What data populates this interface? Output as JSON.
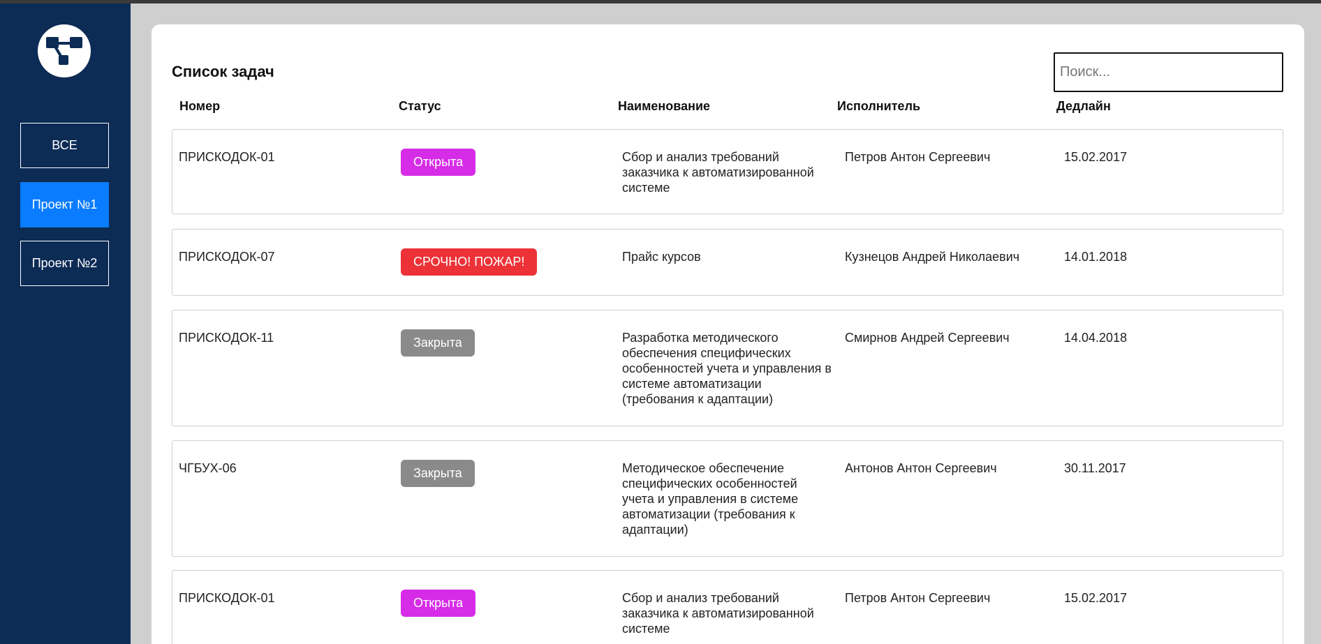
{
  "sidebar": {
    "logo_icon": "hierarchy-icon",
    "items": [
      {
        "label": "ВСЕ",
        "active": false
      },
      {
        "label": "Проект №1",
        "active": true
      },
      {
        "label": "Проект №2",
        "active": false
      }
    ]
  },
  "main": {
    "title": "Список задач",
    "search": {
      "placeholder": "Поиск...",
      "value": ""
    },
    "columns": [
      "Номер",
      "Статус",
      "Наименование",
      "Исполнитель",
      "Дедлайн"
    ],
    "status_colors": {
      "Открыта": "#d62ce8",
      "СРОЧНО! ПОЖАР!": "#ec3237",
      "Закрыта": "#8a8a8a"
    },
    "rows": [
      {
        "number": "ПРИСКОДОК-01",
        "status": "Открыта",
        "name": "Сбор и анализ требований заказчика к автоматизированной системе",
        "executor": "Петров Антон Сергеевич",
        "deadline": "15.02.2017"
      },
      {
        "number": "ПРИСКОДОК-07",
        "status": "СРОЧНО! ПОЖАР!",
        "name": "Прайс курсов",
        "executor": "Кузнецов Андрей Николаевич",
        "deadline": "14.01.2018"
      },
      {
        "number": "ПРИСКОДОК-11",
        "status": "Закрыта",
        "name": "Разработка методического обеспечения специфических особенностей учета и управления в системе автоматизации (требования к адаптации)",
        "executor": "Смирнов Андрей Сергеевич",
        "deadline": "14.04.2018"
      },
      {
        "number": "ЧГБУХ-06",
        "status": "Закрыта",
        "name": "Методическое обеспечение специфических особенностей учета и управления в системе автоматизации (требования к адаптации)",
        "executor": "Антонов Антон Сергеевич",
        "deadline": "30.11.2017"
      },
      {
        "number": "ПРИСКОДОК-01",
        "status": "Открыта",
        "name": "Сбор и анализ требований заказчика к автоматизированной системе",
        "executor": "Петров Антон Сергеевич",
        "deadline": "15.02.2017"
      }
    ]
  }
}
